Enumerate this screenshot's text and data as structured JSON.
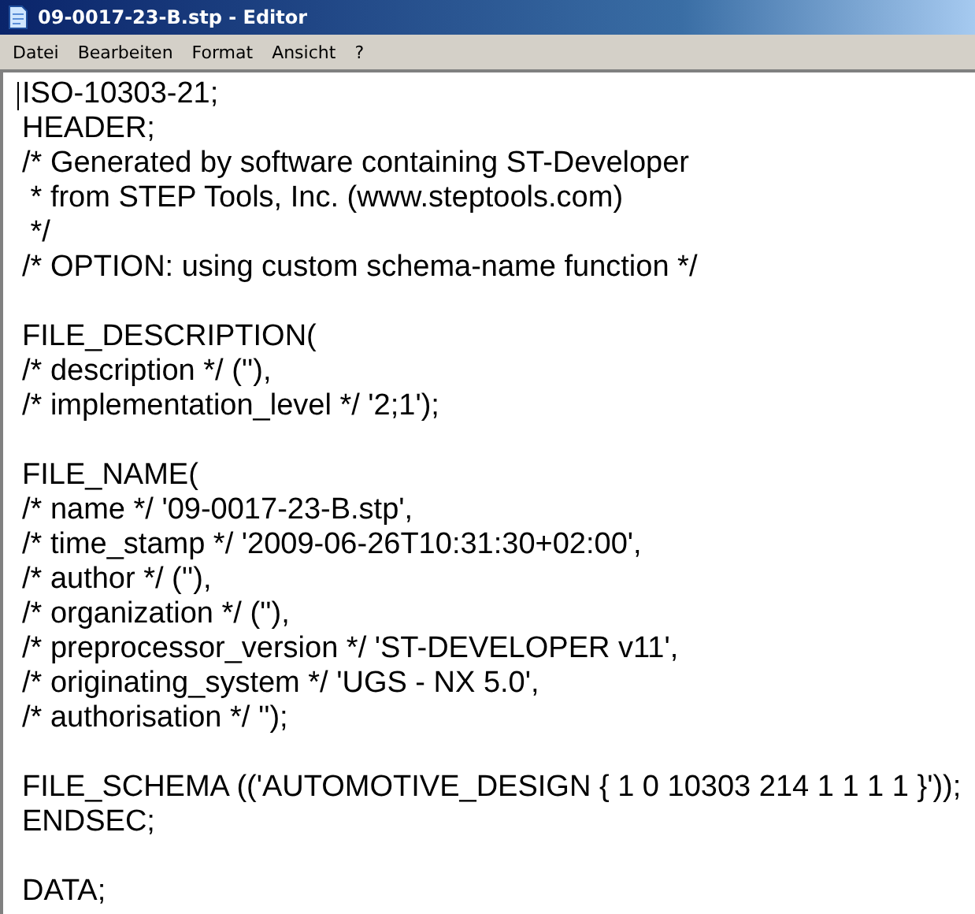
{
  "window": {
    "title": "09-0017-23-B.stp - Editor"
  },
  "menu": [
    "Datei",
    "Bearbeiten",
    "Format",
    "Ansicht",
    "?"
  ],
  "blocks": [
    [
      "ISO-10303-21;",
      "HEADER;",
      "/* Generated by software containing ST-Developer",
      " * from STEP Tools, Inc. (www.steptools.com)",
      " */",
      "/* OPTION: using custom schema-name function */"
    ],
    [
      "FILE_DESCRIPTION(",
      "/* description */ (''),",
      "/* implementation_level */ '2;1');"
    ],
    [
      "FILE_NAME(",
      "/* name */ '09-0017-23-B.stp',",
      "/* time_stamp */ '2009-06-26T10:31:30+02:00',",
      "/* author */ (''),",
      "/* organization */ (''),",
      "/* preprocessor_version */ 'ST-DEVELOPER v11',",
      "/* originating_system */ 'UGS - NX 5.0',",
      "/* authorisation */ '');"
    ],
    [
      "FILE_SCHEMA (('AUTOMOTIVE_DESIGN { 1 0 10303 214 1 1 1 1 }'));",
      "ENDSEC;"
    ],
    [
      "DATA;"
    ]
  ]
}
